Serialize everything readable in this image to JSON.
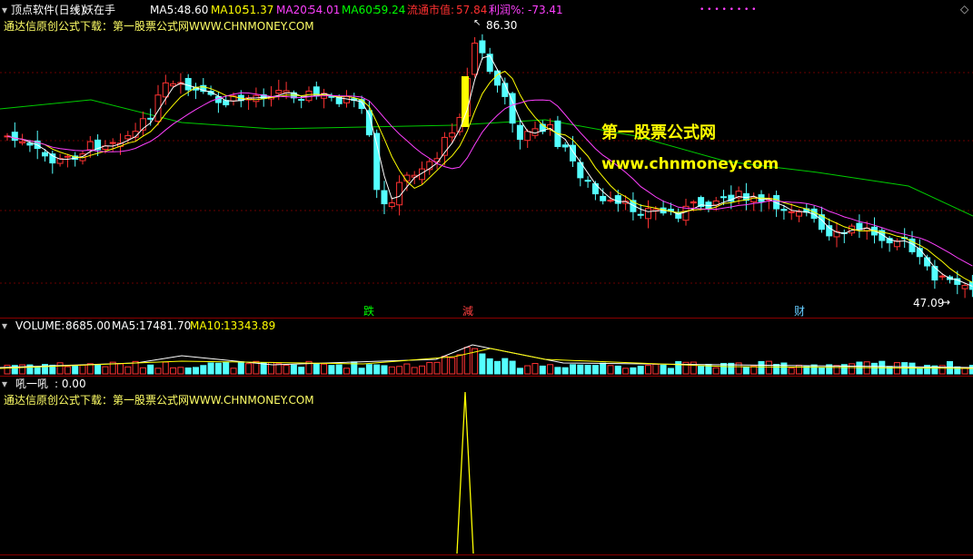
{
  "window": {
    "app_title": "顶点软件(日线)",
    "stock_name": "妖在手",
    "corner_icon": "diamond-icon"
  },
  "main_header": {
    "ma5": {
      "label": "MA5:",
      "value": "48.60",
      "color": "#ffffff"
    },
    "ma10": {
      "label": "MA10:",
      "value": "51.37",
      "color": "#ffff00"
    },
    "ma20": {
      "label": "MA20:",
      "value": "54.01",
      "color": "#ff40ff"
    },
    "ma60": {
      "label": "MA60:",
      "value": "59.24",
      "color": "#00ff00"
    },
    "market_cap": {
      "label": "流通市值:",
      "value": "57.84",
      "color": "#ff3030"
    },
    "profit": {
      "label": "利润%:",
      "value": "-73.41",
      "color": "#ff40ff"
    },
    "dots": "• • • • • • • •"
  },
  "watermark_line": "通达信原创公式下载：第一股票公式网WWW.CHNMONEY.COM",
  "overlay": {
    "title": "第一股票公式网",
    "url": "www.chnmoney.com",
    "color": "#ffff00"
  },
  "price_chart": {
    "high_label": "86.30",
    "low_label": "47.09",
    "event_labels": [
      {
        "text": "跌",
        "color": "#00ff00"
      },
      {
        "text": "減",
        "color": "#ff4040"
      },
      {
        "text": "财",
        "color": "#66ccff"
      }
    ],
    "up_color": "#ff3232",
    "down_color": "#54ffff"
  },
  "volume_header": {
    "volume": {
      "label": "VOLUME:",
      "value": "8685.00",
      "color": "#ffffff"
    },
    "ma5": {
      "label": "MA5:",
      "value": "17481.70",
      "color": "#ffffff"
    },
    "ma10": {
      "label": "MA10:",
      "value": "13343.89",
      "color": "#ffff00"
    }
  },
  "indicator_header": {
    "name": "吼一吼",
    "value": ": 0.00"
  },
  "indicator_watermark": "通达信原创公式下载：第一股票公式网WWW.CHNMONEY.COM"
}
